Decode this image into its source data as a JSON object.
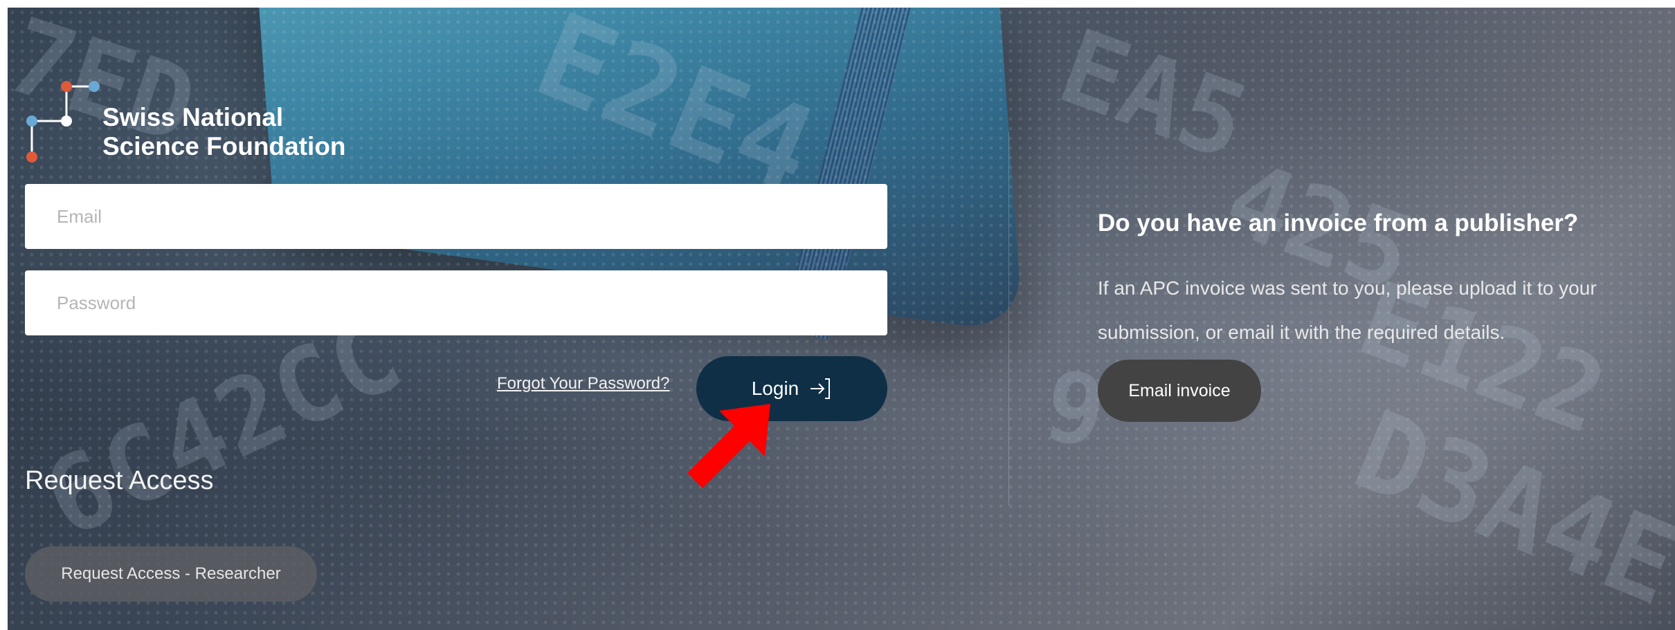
{
  "logo": {
    "line1": "Swiss National",
    "line2": "Science Foundation"
  },
  "login_form": {
    "email_placeholder": "Email",
    "password_placeholder": "Password",
    "forgot_link": "Forgot Your Password?",
    "login_button": "Login"
  },
  "request_access": {
    "title": "Request Access",
    "button": "Request Access - Researcher"
  },
  "invoice": {
    "title": "Do you have an invoice from a publisher?",
    "text": "If an APC invoice was sent to you, please upload it to your submission, or email it with the required details.",
    "button": "Email invoice"
  },
  "colors": {
    "login_button": "#0f2f46",
    "logo_accent_red": "#e05a3a",
    "logo_accent_blue": "#6aa8d6",
    "annotation_arrow": "#ff0000"
  }
}
